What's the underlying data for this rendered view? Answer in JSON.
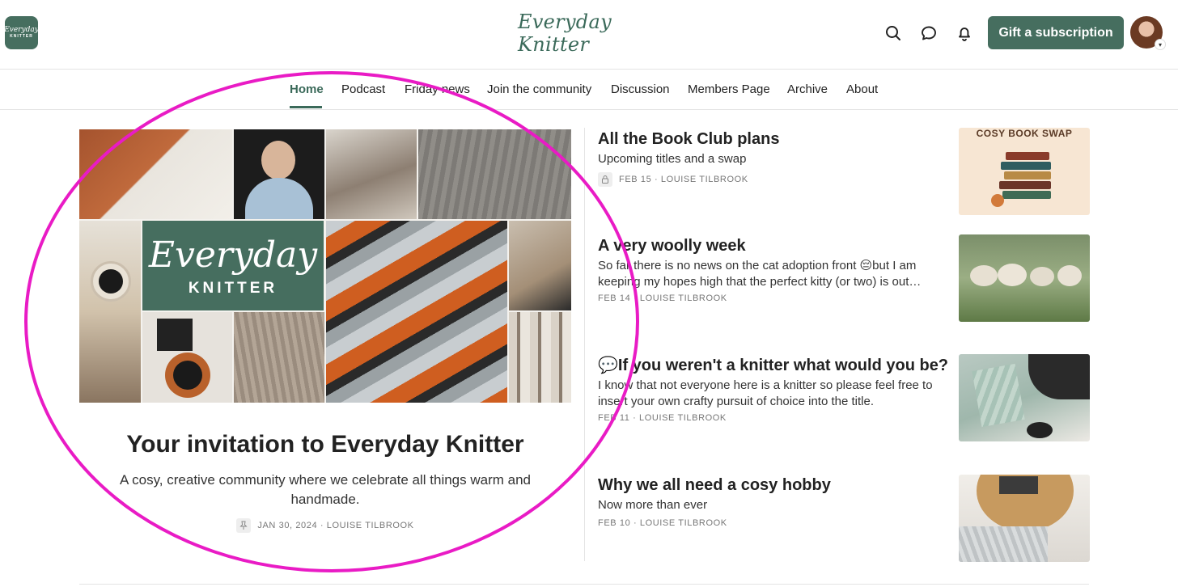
{
  "header": {
    "publication_logo": {
      "line1": "Everyday",
      "line2": "KNITTER"
    },
    "wordmark": "Everyday Knitter",
    "gift_button": "Gift a subscription",
    "icons": [
      "search-icon",
      "chat-icon",
      "bell-icon"
    ],
    "accent_color": "#466e5f"
  },
  "nav": {
    "items": [
      {
        "label": "Home",
        "active": true
      },
      {
        "label": "Podcast"
      },
      {
        "label": "Friday news"
      },
      {
        "label": "Join the community"
      },
      {
        "label": "Discussion"
      },
      {
        "label": "Members Page"
      },
      {
        "label": "Archive"
      },
      {
        "label": "About"
      }
    ]
  },
  "hero": {
    "logo_script": "Everyday",
    "logo_caps": "KNITTER",
    "title": "Your invitation to Everyday Knitter",
    "subtitle": "A cosy, creative community where we celebrate all things warm and handmade.",
    "meta": "JAN 30, 2024 · LOUISE TILBROOK",
    "pinned_icon": "pin-icon"
  },
  "posts": [
    {
      "title": "All the Book Club plans",
      "subtitle": "Upcoming titles and a swap",
      "meta": "FEB 15 · LOUISE TILBROOK",
      "locked": true,
      "thumb_text": "COSY BOOK SWAP"
    },
    {
      "title": "A very woolly week",
      "subtitle": "So far there is no news on the cat adoption front 😔but I am keeping my hopes high that the perfect kitty (or two) is out…",
      "meta": "FEB 14 · LOUISE TILBROOK"
    },
    {
      "title": "💬If you weren't a knitter what would you be?",
      "subtitle": "I know that not everyone here is a knitter so please feel free to insert your own crafty pursuit of choice into the title.",
      "meta": "FEB 11 · LOUISE TILBROOK"
    },
    {
      "title": "Why we all need a cosy hobby",
      "subtitle": "Now more than ever",
      "meta": "FEB 10 · LOUISE TILBROOK"
    }
  ],
  "annotation": {
    "highlight_color": "#e91bc5"
  }
}
